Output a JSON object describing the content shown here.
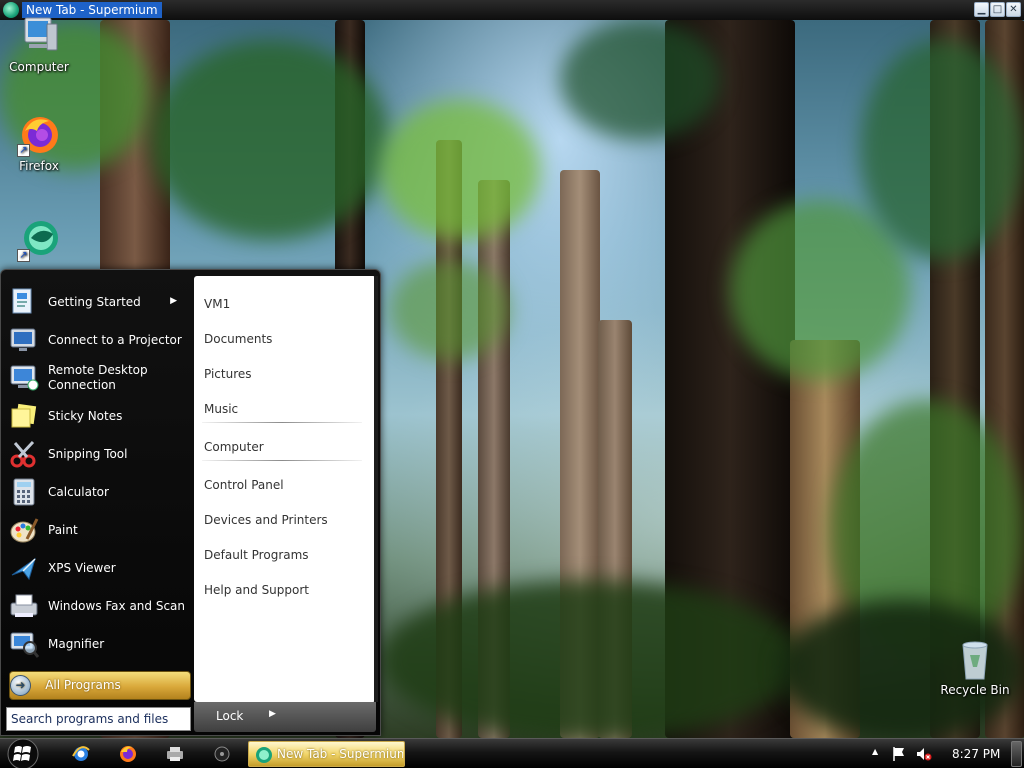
{
  "window": {
    "title": "New Tab - Supermium",
    "minimize_symbol": "▁",
    "maximize_symbol": "□",
    "close_symbol": "✕"
  },
  "desktop": {
    "icons": [
      {
        "label": "Computer",
        "icon": "computer-icon"
      },
      {
        "label": "Firefox",
        "icon": "firefox-icon"
      },
      {
        "label": "",
        "icon": "supermium-icon"
      },
      {
        "label": "Recycle Bin",
        "icon": "recycle-bin-icon"
      }
    ]
  },
  "start_menu": {
    "programs": [
      {
        "label": "Getting Started",
        "icon": "getting-started-icon",
        "has_submenu": true
      },
      {
        "label": "Connect to a Projector",
        "icon": "projector-icon"
      },
      {
        "label": "Remote Desktop Connection",
        "icon": "remote-desktop-icon"
      },
      {
        "label": "Sticky Notes",
        "icon": "sticky-notes-icon"
      },
      {
        "label": "Snipping Tool",
        "icon": "snipping-tool-icon"
      },
      {
        "label": "Calculator",
        "icon": "calculator-icon"
      },
      {
        "label": "Paint",
        "icon": "paint-icon"
      },
      {
        "label": "XPS Viewer",
        "icon": "xps-viewer-icon"
      },
      {
        "label": "Windows Fax and Scan",
        "icon": "fax-scan-icon"
      },
      {
        "label": "Magnifier",
        "icon": "magnifier-icon"
      }
    ],
    "submenu_arrow": "▶",
    "all_programs": "All Programs",
    "all_programs_arrow": "➜",
    "search_placeholder": "Search programs and files",
    "places": [
      "VM1",
      "Documents",
      "Pictures",
      "Music",
      "Computer",
      "Control Panel",
      "Devices and Printers",
      "Default Programs",
      "Help and Support"
    ],
    "lock_label": "Lock",
    "lock_arrow": "▶"
  },
  "taskbar": {
    "start_orb": "windows-logo-icon",
    "quick_launch": [
      "internet-explorer-icon",
      "firefox-icon",
      "printer-icon",
      "media-icon"
    ],
    "task_button": "New Tab - Supermium",
    "tray_up_arrow": "▲",
    "tray_icons": [
      "action-center-flag-icon",
      "volume-muted-icon"
    ],
    "clock": "8:27 PM"
  },
  "colors": {
    "taskbar": "#000000",
    "start_menu": "#0a0a0a",
    "task_button_gold": "#f2d66b",
    "title_highlight": "#1e62c8"
  }
}
